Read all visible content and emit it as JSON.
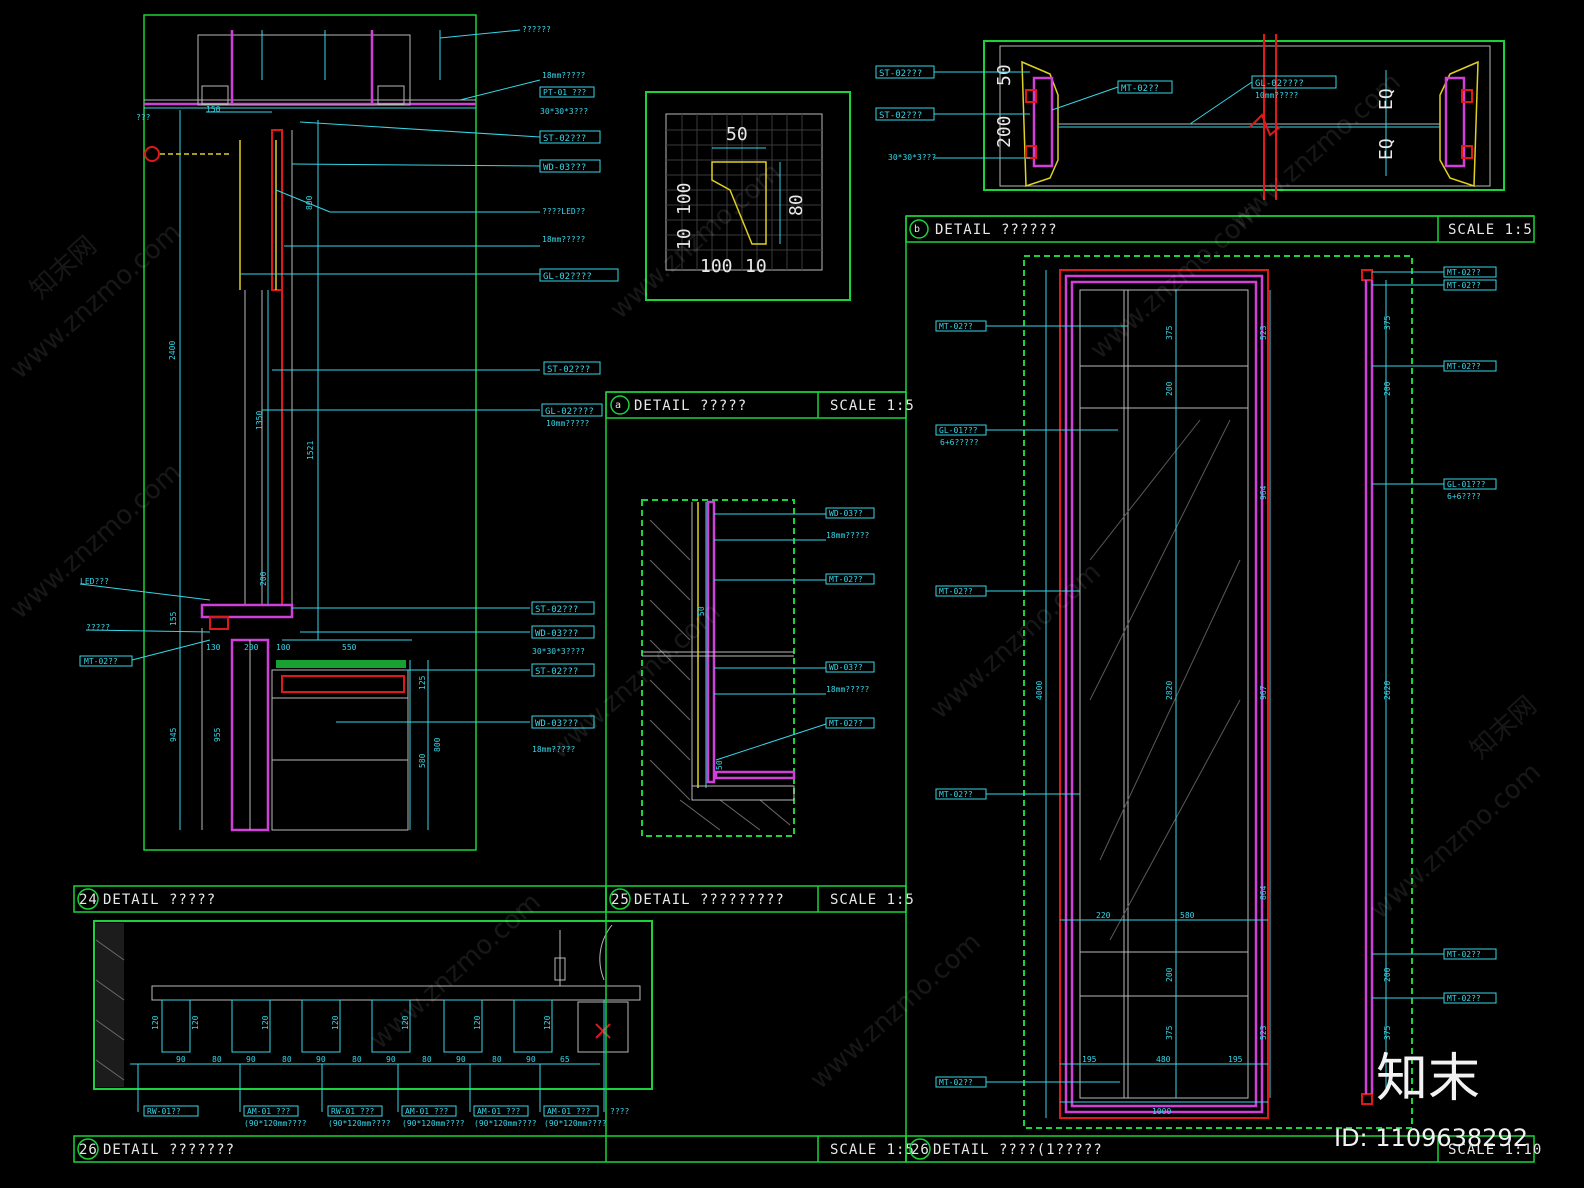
{
  "titles": {
    "t24": {
      "num": "24",
      "label": "DETAIL ?????",
      "scale": "SCALE 1:5"
    },
    "t25": {
      "num": "25",
      "label": "DETAIL ?????????",
      "scale": "SCALE 1:5"
    },
    "t26": {
      "num": "26",
      "label": "DETAIL ???????",
      "scale": "SCALE 1:5"
    },
    "t26b": {
      "num": "26",
      "label": "DETAIL ????(1?????",
      "scale": "SCALE 1:10"
    },
    "ta": {
      "num": "a",
      "label": "DETAIL ?????",
      "scale": "SCALE 1:5"
    },
    "tb": {
      "num": "b",
      "label": "DETAIL ??????",
      "scale": "SCALE 1:5"
    }
  },
  "tags": {
    "st02": "ST-02???",
    "wd03": "WD-03???",
    "gl02": "GL-02????",
    "pt01": "PT-01 ???",
    "mt02": "MT-02??",
    "mt02b": "MT-02??",
    "mt02c": "MT-02??",
    "gl01": "GL-01???",
    "gl01b": "GL-01???",
    "wd03b": "WD-03???",
    "st02b": "ST-02???",
    "st02c": "ST-02???",
    "mt02d": "MT-02??",
    "wd03c": "WD-03??",
    "wd03d": "WD-03??",
    "mt02e": "MT-02??",
    "mt02f": "MT-02??",
    "st02d": "ST-02???",
    "gl02b": "GL-02????",
    "wd03e": "WD-03???",
    "st02e": "ST-02???",
    "gl02c": "GL-02????",
    "st02f": "ST-02???",
    "mt02g": "MT-02??",
    "mt02h": "MT-02??",
    "mt02i": "MT-02??",
    "gl01c": "GL-01???",
    "mt02j": "MT-02??",
    "mt02k": "MT-02??",
    "mt02l": "MT-02??",
    "mt02m": "MT-02??",
    "mt02n": "MT-02??",
    "mt02o": "MT-02??",
    "am01a": "AM-01 ???",
    "am01b": "AM-01 ???",
    "am01c": "AM-01 ???",
    "am01d": "AM-01 ???",
    "am01e": "AM-01 ???",
    "rw01": "RW-01??",
    "rw01b": "RW-01 ???"
  },
  "notes": {
    "n1": "??????",
    "n2": "18mm?????",
    "n3": "30*30*3???",
    "n4": "????LED??",
    "n5": "10mm?????",
    "n6": "LED???",
    "n7": "?????",
    "n8": "???",
    "n9": "30*30*3????",
    "n10": "18mm?????",
    "n11": "??????",
    "n12": "(90*120mm????",
    "n13": "????",
    "n14": "6+6?????",
    "n15": "6+6????",
    "n16": "10mm?????"
  },
  "dims": {
    "d150": "150",
    "d2400": "2400",
    "d1521": "1521",
    "d1350": "1350",
    "d800": "800",
    "d200": "200",
    "d155": "155",
    "d130": "130",
    "d100": "100",
    "d550": "550",
    "d945": "945",
    "d955": "955",
    "d125": "125",
    "d580": "580",
    "d30": "30",
    "d50": "50",
    "d80": "80",
    "d10": "10",
    "d100s": "100",
    "d4000": "4000",
    "d2820": "2820",
    "d2620": "2620",
    "d375": "375",
    "d964": "964",
    "d967": "967",
    "d864": "864",
    "d523": "523",
    "d1000": "1000",
    "d195": "195",
    "d480": "480",
    "d220": "220",
    "d15": "15",
    "d120": "120",
    "d90": "90",
    "d65": "65",
    "dEQ": "EQ"
  },
  "watermark": "www.znzmo.com",
  "watermark_cn": "知末网",
  "brand": "知末",
  "id_text": "ID: 1109638292"
}
